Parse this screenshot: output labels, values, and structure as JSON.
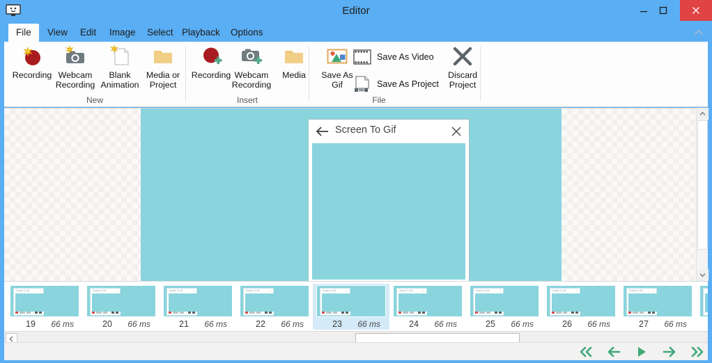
{
  "window": {
    "title": "Editor",
    "app_icon": "monitor-icon",
    "minimize_label": "Minimize",
    "maximize_label": "Maximize",
    "close_label": "Close",
    "accent_color": "#5aaef3",
    "close_color": "#e04343"
  },
  "tabs": [
    {
      "label": "File",
      "active": true
    },
    {
      "label": "View",
      "active": false
    },
    {
      "label": "Edit",
      "active": false
    },
    {
      "label": "Image",
      "active": false
    },
    {
      "label": "Select",
      "active": false
    },
    {
      "label": "Playback",
      "active": false
    },
    {
      "label": "Options",
      "active": false
    }
  ],
  "ribbon": {
    "collapse_icon": "chevron-up-icon",
    "groups": [
      {
        "name": "New",
        "label": "New",
        "items": [
          {
            "label": "Recording",
            "icon": "record-dot-new-icon"
          },
          {
            "label": "Webcam\nRecording",
            "icon": "webcam-new-icon"
          },
          {
            "label": "Blank\nAnimation",
            "icon": "blank-page-new-icon"
          },
          {
            "label": "Media or\nProject",
            "icon": "folder-icon"
          }
        ]
      },
      {
        "name": "Insert",
        "label": "Insert",
        "items": [
          {
            "label": "Recording",
            "icon": "record-dot-add-icon"
          },
          {
            "label": "Webcam\nRecording",
            "icon": "webcam-add-icon"
          },
          {
            "label": "Media",
            "icon": "folder-icon"
          }
        ]
      },
      {
        "name": "File",
        "label": "File",
        "items": [
          {
            "label": "Save As\nGif",
            "icon": "picture-icon"
          },
          {
            "label": "Save As Video",
            "icon": "film-icon"
          },
          {
            "label": "Save As Project",
            "icon": "project-file-icon"
          },
          {
            "label": "Discard\nProject",
            "icon": "x-cross-icon"
          }
        ]
      }
    ]
  },
  "canvas": {
    "background": "checkerboard-transparency",
    "frame_color": "#8ad4dd",
    "cursor": "arrow-cursor",
    "dialog": {
      "title": "Screen To Gif",
      "back_icon": "back-arrow-icon",
      "close_icon": "close-x-icon",
      "body_color": "#8ad4dd"
    },
    "scrollbar": {
      "up_icon": "chevron-up-icon",
      "down_icon": "chevron-down-icon"
    }
  },
  "filmstrip": {
    "frames": [
      {
        "number": "19",
        "delay": "66 ms",
        "selected": false
      },
      {
        "number": "20",
        "delay": "66 ms",
        "selected": false
      },
      {
        "number": "21",
        "delay": "66 ms",
        "selected": false
      },
      {
        "number": "22",
        "delay": "66 ms",
        "selected": false
      },
      {
        "number": "23",
        "delay": "66 ms",
        "selected": true
      },
      {
        "number": "24",
        "delay": "66 ms",
        "selected": false
      },
      {
        "number": "25",
        "delay": "66 ms",
        "selected": false
      },
      {
        "number": "26",
        "delay": "66 ms",
        "selected": false
      },
      {
        "number": "27",
        "delay": "66 ms",
        "selected": false
      }
    ],
    "thumb_title": "Screen To Gif"
  },
  "scrollbar_h": {
    "left_button_icon": "chevron-left-icon"
  },
  "playback": {
    "buttons": [
      {
        "name": "skip-back",
        "icon": "double-chevron-left-icon"
      },
      {
        "name": "previous-frame",
        "icon": "arrow-left-icon"
      },
      {
        "name": "play",
        "icon": "play-triangle-icon"
      },
      {
        "name": "next-frame",
        "icon": "arrow-right-icon"
      },
      {
        "name": "skip-forward",
        "icon": "double-chevron-right-icon"
      }
    ],
    "color": "#3fa877"
  }
}
